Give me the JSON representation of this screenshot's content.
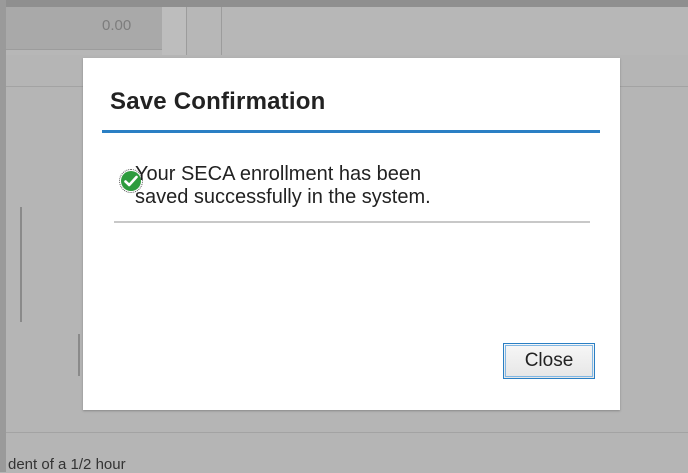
{
  "background": {
    "amount_value": "0.00",
    "footer_text": "dent of a 1/2 hour"
  },
  "dialog": {
    "title": "Save Confirmation",
    "message_line1": "Your SECA enrollment has been",
    "message_line2": "saved successfully in the system.",
    "status_icon": "check-circle-icon",
    "close_label": "Close"
  },
  "colors": {
    "accent": "#2a7fc4",
    "success": "#2d9b3e",
    "overlay": "#b5b5b5",
    "dialog_bg": "#ffffff"
  }
}
